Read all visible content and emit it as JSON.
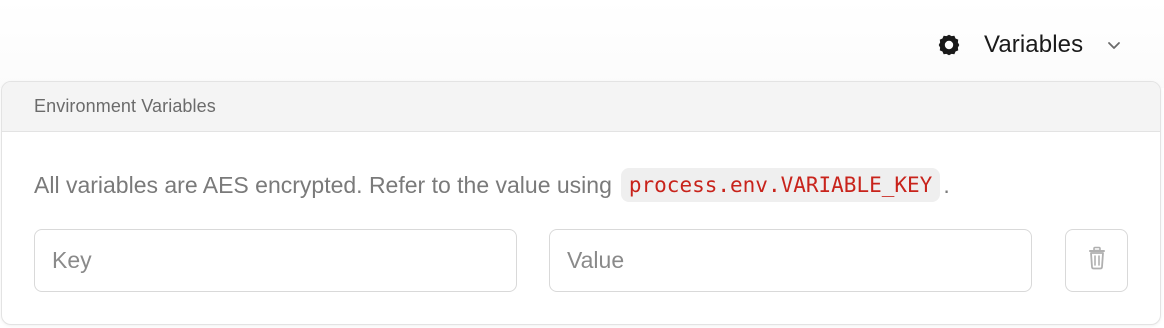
{
  "toolbar": {
    "variables_label": "Variables",
    "icons": {
      "settings": "gear-icon",
      "expand": "chevron-down-icon"
    }
  },
  "env_panel": {
    "title": "Environment Variables",
    "description": "All variables are AES encrypted. Refer to the value using",
    "code_snippet": "process.env.VARIABLE_KEY",
    "trailing_punctuation": ".",
    "key_input": {
      "value": "",
      "placeholder": "Key"
    },
    "value_input": {
      "value": "",
      "placeholder": "Value"
    },
    "delete_icon": "trash-icon"
  },
  "colors": {
    "code_text": "#c8231b",
    "code_background": "#efefef",
    "header_background": "#f4f4f4",
    "muted_text": "#7a7a7a"
  }
}
